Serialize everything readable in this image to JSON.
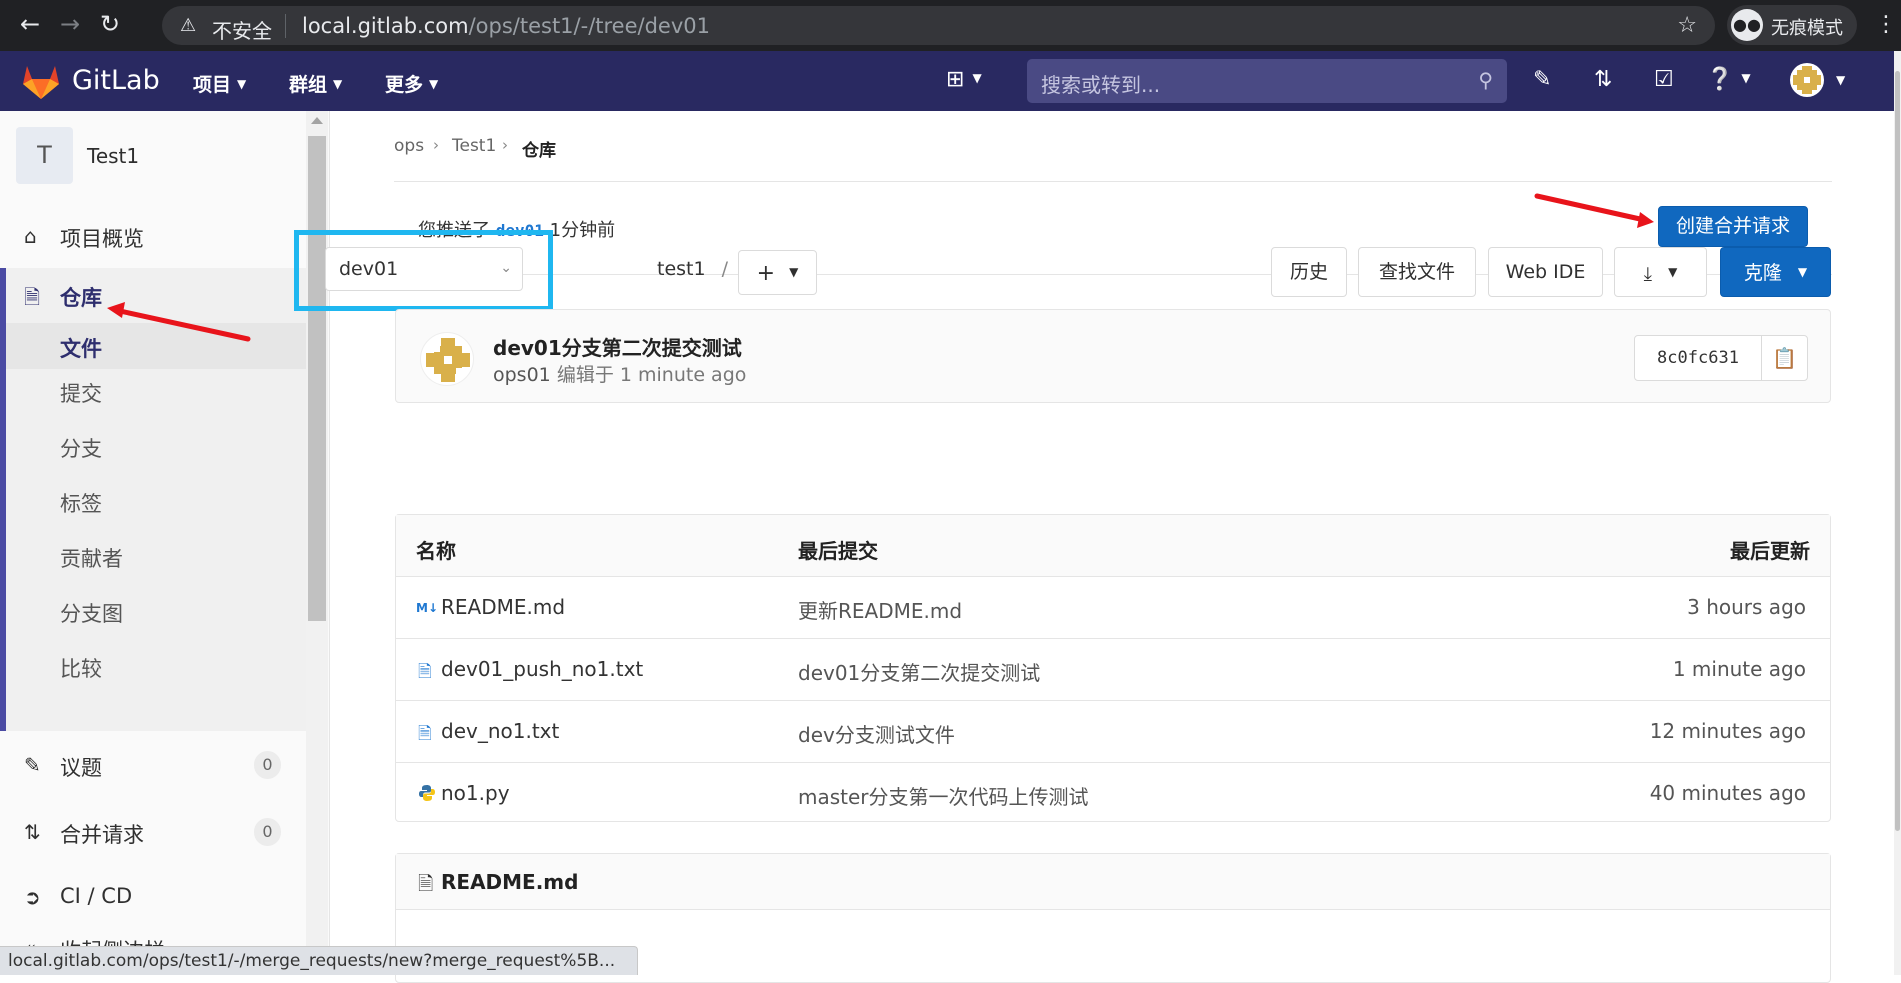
{
  "browser": {
    "insecure_label": "不安全",
    "url_host": "local.gitlab.com",
    "url_path": "/ops/test1/-/tree/dev01",
    "incognito_label": "无痕模式"
  },
  "gitlab_header": {
    "brand": "GitLab",
    "menus": [
      "项目",
      "群组",
      "更多"
    ],
    "search_placeholder": "搜索或转到..."
  },
  "sidebar": {
    "project_initial": "T",
    "project_name": "Test1",
    "overview": "项目概览",
    "repository": "仓库",
    "repo_sub": [
      "文件",
      "提交",
      "分支",
      "标签",
      "贡献者",
      "分支图",
      "比较"
    ],
    "issues": "议题",
    "issues_count": "0",
    "merge_requests": "合并请求",
    "merge_requests_count": "0",
    "cicd": "CI / CD",
    "collapse": "收起侧边栏"
  },
  "breadcrumb": [
    "ops",
    "Test1",
    "仓库"
  ],
  "push_banner": {
    "prefix": "您推送了",
    "branch": "dev01",
    "suffix": "1分钟前",
    "button": "创建合并请求"
  },
  "toolbar": {
    "branch": "dev01",
    "path_root": "test1",
    "path_sep": "/",
    "history": "历史",
    "find_file": "查找文件",
    "web_ide": "Web IDE",
    "clone": "克隆"
  },
  "last_commit": {
    "title": "dev01分支第二次提交测试",
    "author": "ops01",
    "edited_label": "编辑于",
    "time": "1 minute ago",
    "sha": "8c0fc631"
  },
  "file_table": {
    "headers": [
      "名称",
      "最后提交",
      "最后更新"
    ],
    "rows": [
      {
        "name": "README.md",
        "icon": "markdown-icon",
        "commit": "更新README.md",
        "updated": "3 hours ago"
      },
      {
        "name": "dev01_push_no1.txt",
        "icon": "file-icon",
        "commit": "dev01分支第二次提交测试",
        "updated": "1 minute ago"
      },
      {
        "name": "dev_no1.txt",
        "icon": "file-icon",
        "commit": "dev分支测试文件",
        "updated": "12 minutes ago"
      },
      {
        "name": "no1.py",
        "icon": "python-icon",
        "commit": "master分支第一次代码上传测试",
        "updated": "40 minutes ago"
      }
    ]
  },
  "readme": {
    "title": "README.md"
  },
  "status_bar": "local.gitlab.com/ops/test1/-/merge_requests/new?merge_request%5B...",
  "colors": {
    "header_bg": "#292961",
    "primary": "#1068bf",
    "annotation_red": "#e8141b",
    "annotation_highlight": "#1fb7f0"
  }
}
